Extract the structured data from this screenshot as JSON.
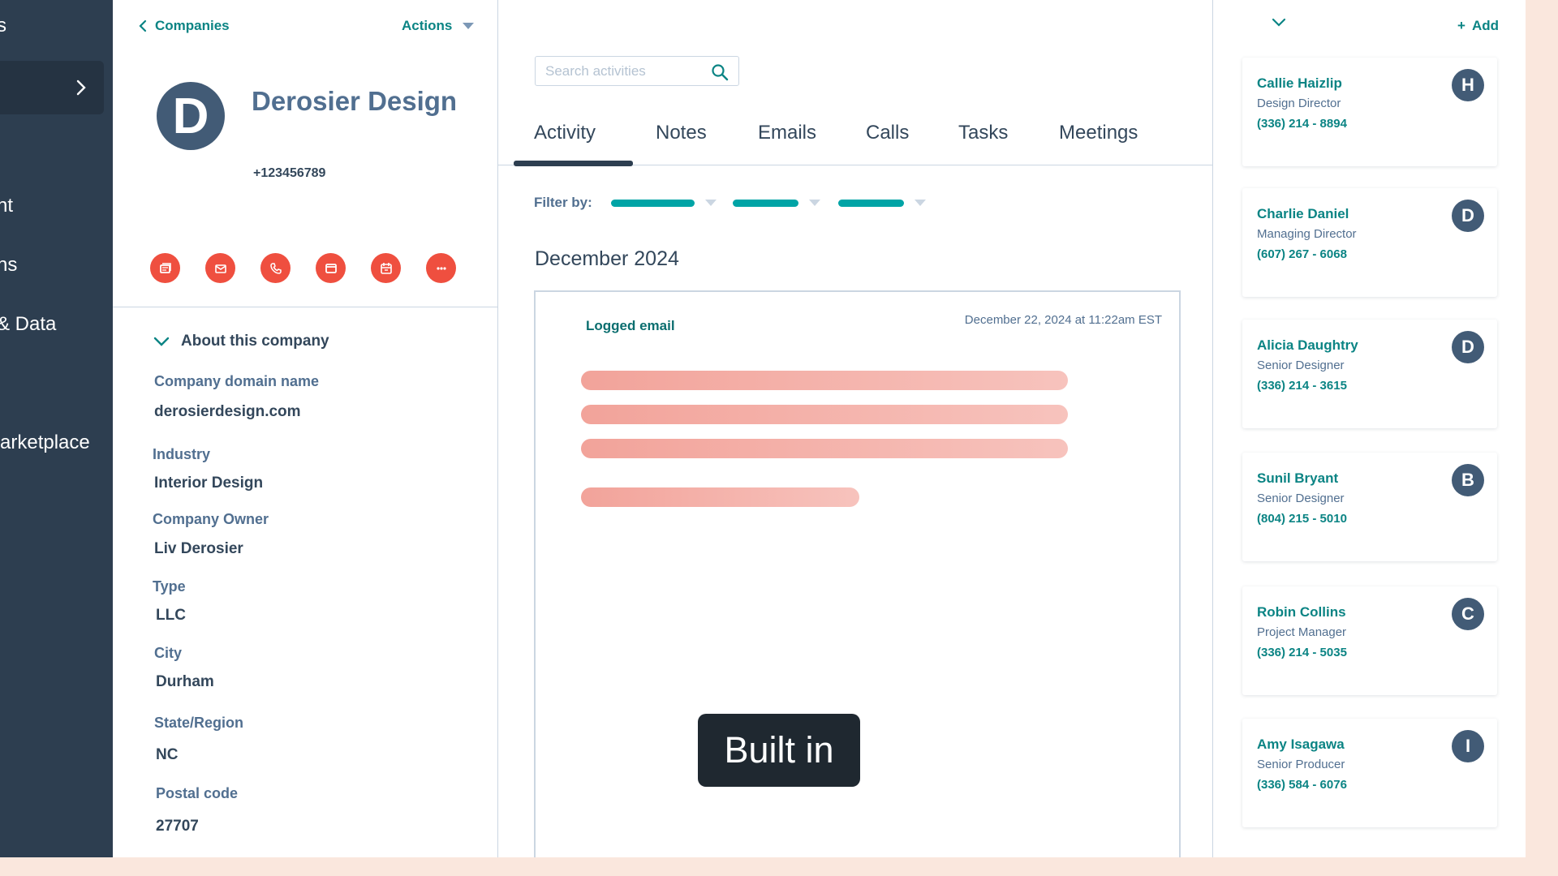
{
  "nav": {
    "items": [
      {
        "label": "s"
      },
      {
        "label": "nt"
      },
      {
        "label": "ns"
      },
      {
        "label": "& Data"
      },
      {
        "label": "arketplace"
      }
    ]
  },
  "company": {
    "back_label": "Companies",
    "actions_label": "Actions",
    "avatar_initial": "D",
    "name": "Derosier Design",
    "phone": "+123456789",
    "about_label": "About this company",
    "properties": [
      {
        "label": "Company domain name",
        "value": "derosierdesign.com"
      },
      {
        "label": "Industry",
        "value": "Interior Design"
      },
      {
        "label": "Company Owner",
        "value": "Liv Derosier"
      },
      {
        "label": "Type",
        "value": "LLC"
      },
      {
        "label": "City",
        "value": "Durham"
      },
      {
        "label": "State/Region",
        "value": "NC"
      },
      {
        "label": "Postal code",
        "value": "27707"
      }
    ],
    "action_icons": [
      "note-icon",
      "email-icon",
      "phone-icon",
      "task-icon",
      "calendar-icon",
      "more-icon"
    ]
  },
  "activity": {
    "search_placeholder": "Search activities",
    "tabs": [
      {
        "label": "Activity"
      },
      {
        "label": "Notes"
      },
      {
        "label": "Emails"
      },
      {
        "label": "Calls"
      },
      {
        "label": "Tasks"
      },
      {
        "label": "Meetings"
      }
    ],
    "active_tab": "Activity",
    "filter_label": "Filter by:",
    "month": "December 2024",
    "card": {
      "title": "Logged email",
      "date": "December 22, 2024 at 11:22am EST"
    },
    "tooltip": "Built in"
  },
  "contacts": {
    "add_label": "Add",
    "items": [
      {
        "name": "Callie Haizlip",
        "role": "Design Director",
        "phone": "(336) 214 - 8894",
        "initial": "H"
      },
      {
        "name": "Charlie Daniel",
        "role": "Managing Director",
        "phone": "(607) 267 - 6068",
        "initial": "D"
      },
      {
        "name": "Alicia Daughtry",
        "role": "Senior Designer",
        "phone": "(336) 214 - 3615",
        "initial": "D"
      },
      {
        "name": "Sunil Bryant",
        "role": "Senior Designer",
        "phone": "(804) 215 - 5010",
        "initial": "B"
      },
      {
        "name": "Robin Collins",
        "role": "Project Manager",
        "phone": "(336) 214 - 5035",
        "initial": "C"
      },
      {
        "name": "Amy Isagawa",
        "role": "Senior Producer",
        "phone": "(336) 584 - 6076",
        "initial": "I"
      }
    ]
  },
  "colors": {
    "nav_bg": "#2d3e50",
    "accent_teal": "#0b8484",
    "action_red": "#ef4f3f",
    "page_bg": "#fae7dd"
  }
}
